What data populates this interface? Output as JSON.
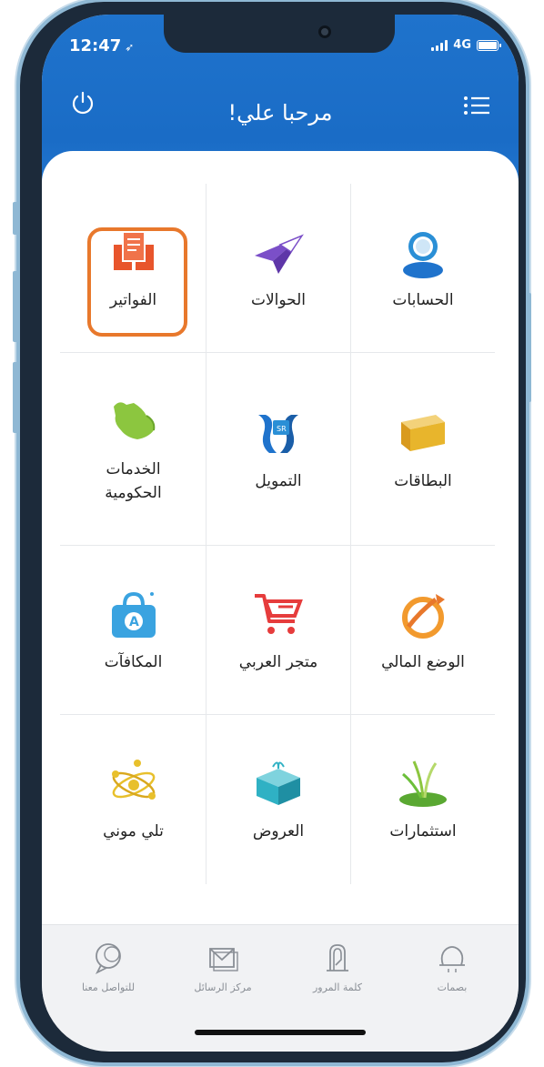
{
  "status_bar": {
    "time": "12:47",
    "location_arrow": "➶",
    "network": "4G"
  },
  "header": {
    "greeting": "مرحبا علي!",
    "power_icon": "power-icon",
    "menu_icon": "menu-icon"
  },
  "services": {
    "rows": [
      [
        {
          "label": "الحسابات",
          "icon": "accounts-icon",
          "color": "#2a8fd6"
        },
        {
          "label": "الحوالات",
          "icon": "transfers-icon",
          "color": "#7b4fc8"
        },
        {
          "label": "الفواتير",
          "icon": "bills-icon",
          "color": "#e8552c"
        }
      ],
      [
        {
          "label": "البطاقات",
          "icon": "cards-icon",
          "color": "#e8b52c"
        },
        {
          "label": "التمويل",
          "icon": "financing-icon",
          "color": "#1f73cc"
        },
        {
          "label": "الخدمات الحكومية",
          "icon": "government-services-icon",
          "color": "#8cc63f"
        }
      ],
      [
        {
          "label": "الوضع المالي",
          "icon": "financial-position-icon",
          "color": "#f29a2e"
        },
        {
          "label": "متجر العربي",
          "icon": "store-cart-icon",
          "color": "#e63c3c"
        },
        {
          "label": "المكافآت",
          "icon": "rewards-icon",
          "color": "#3aa3e0"
        }
      ],
      [
        {
          "label": "استثمارات",
          "icon": "investments-icon",
          "color": "#6cbf3a"
        },
        {
          "label": "العروض",
          "icon": "offers-icon",
          "color": "#2fb1c4"
        },
        {
          "label": "تلي موني",
          "icon": "telemoney-icon",
          "color": "#e8c02c"
        }
      ]
    ]
  },
  "bottom_nav": [
    {
      "label": "بصمات",
      "icon": "fingerprint-icon"
    },
    {
      "label": "كلمة المرور",
      "icon": "password-lock-icon"
    },
    {
      "label": "مركز الرسائل",
      "icon": "messages-icon"
    },
    {
      "label": "للتواصل معنا",
      "icon": "contact-chat-icon"
    }
  ],
  "colors": {
    "header_blue": "#1f73cc",
    "highlight_orange": "#e8782c"
  }
}
